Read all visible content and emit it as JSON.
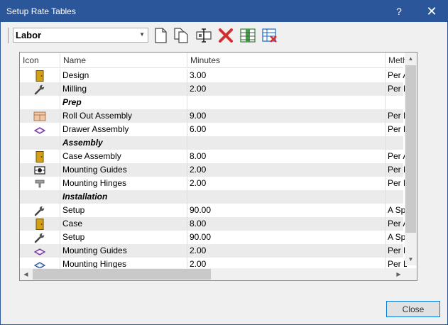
{
  "window": {
    "title": "Setup Rate Tables",
    "help": "?",
    "close": "✕"
  },
  "toolbar": {
    "rate_table": "Labor",
    "icons": [
      "new-icon",
      "copy-icon",
      "rename-icon",
      "delete-icon",
      "columns-icon",
      "delete-table-icon"
    ]
  },
  "grid": {
    "columns": [
      "Icon",
      "Name",
      "Minutes",
      "Meth"
    ],
    "rows": [
      {
        "icon": "door-icon",
        "name": "Design",
        "minutes": "3.00",
        "method": "Per A",
        "category": false
      },
      {
        "icon": "wrench-icon",
        "name": "Milling",
        "minutes": "2.00",
        "method": "Per F",
        "category": false
      },
      {
        "icon": "",
        "name": "Prep",
        "minutes": "",
        "method": "",
        "category": true
      },
      {
        "icon": "cabinet-icon",
        "name": "Roll Out Assembly",
        "minutes": "9.00",
        "method": "Per F",
        "category": false
      },
      {
        "icon": "drawer-icon",
        "name": "Drawer Assembly",
        "minutes": "6.00",
        "method": "Per D",
        "category": false
      },
      {
        "icon": "",
        "name": "Assembly",
        "minutes": "",
        "method": "",
        "category": true
      },
      {
        "icon": "door-icon",
        "name": "Case Assembly",
        "minutes": "8.00",
        "method": "Per A",
        "category": false
      },
      {
        "icon": "guide-icon",
        "name": "Mounting Guides",
        "minutes": "2.00",
        "method": "Per D",
        "category": false
      },
      {
        "icon": "hinge-icon",
        "name": "Mounting Hinges",
        "minutes": "2.00",
        "method": "Per H",
        "category": false
      },
      {
        "icon": "",
        "name": "Installation",
        "minutes": "",
        "method": "",
        "category": true
      },
      {
        "icon": "wrench-icon",
        "name": "Setup",
        "minutes": "90.00",
        "method": "A Spe",
        "category": false
      },
      {
        "icon": "door-icon",
        "name": "Case",
        "minutes": "8.00",
        "method": "Per A",
        "category": false
      },
      {
        "icon": "wrench-icon",
        "name": "Setup",
        "minutes": "90.00",
        "method": "A Spe",
        "category": false
      },
      {
        "icon": "drawer-icon",
        "name": "Mounting Guides",
        "minutes": "2.00",
        "method": "Per D",
        "category": false
      },
      {
        "icon": "drawer-blue-icon",
        "name": "Mounting Hinges",
        "minutes": "2.00",
        "method": "Per D",
        "category": false
      }
    ]
  },
  "footer": {
    "close_label": "Close"
  },
  "colors": {
    "titlebar": "#2b579a",
    "row_alt": "#ebebeb",
    "delete_red": "#d32f2f",
    "focus_border": "#0078d7"
  }
}
